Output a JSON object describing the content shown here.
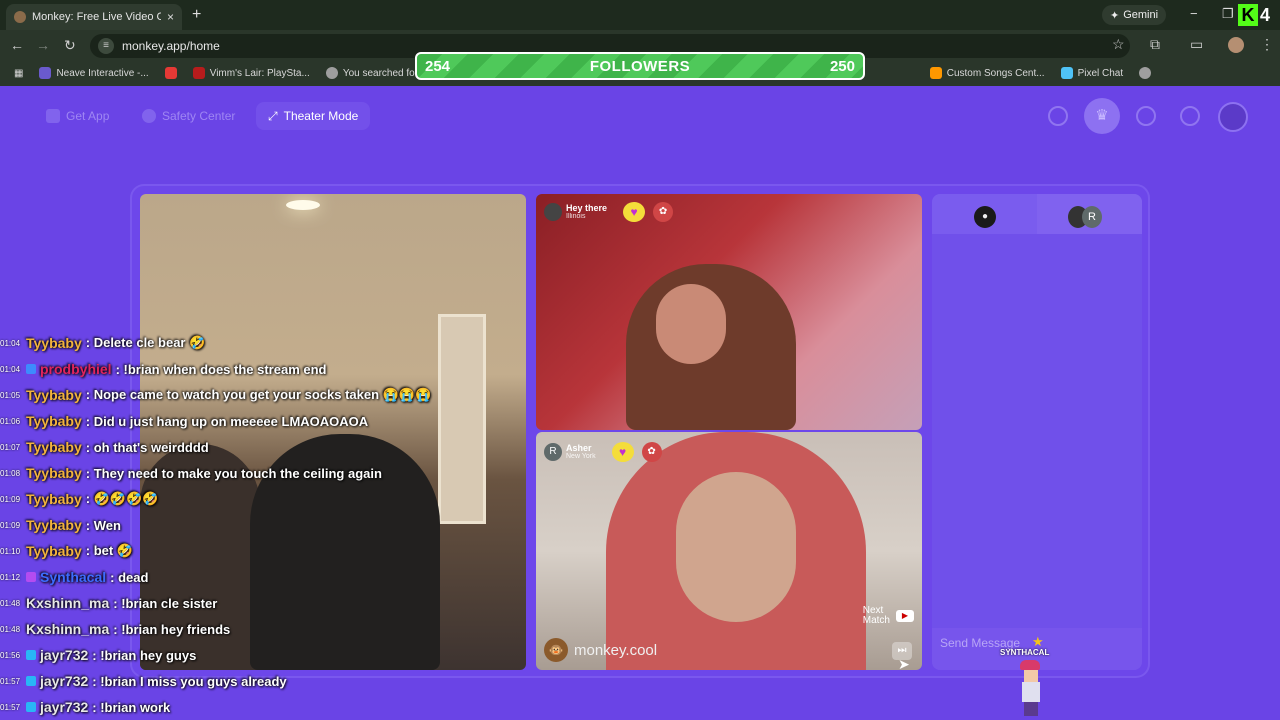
{
  "browser": {
    "tab_title": "Monkey: Free Live Video Ch",
    "tab_close": "×",
    "new_tab": "+",
    "gemini_label": "Gemini",
    "url": "monkey.app/home",
    "window_minimize": "−",
    "window_maximize": "❐",
    "kick_letter": "K",
    "kick_number": "4",
    "bookmarks": [
      {
        "label": "Neave Interactive -...",
        "color": "#6a5acd"
      },
      {
        "label": "",
        "color": "#e53935"
      },
      {
        "label": "Vimm's Lair: PlaySta...",
        "color": "#b71c1c"
      },
      {
        "label": "You searched for su...",
        "color": "#9e9e9e"
      },
      {
        "label": "Custom Songs Cent...",
        "color": "#ff9800"
      },
      {
        "label": "Pixel Chat",
        "color": "#4fc3f7"
      },
      {
        "label": "",
        "color": "#9e9e9e"
      }
    ]
  },
  "followers_goal": {
    "current": "254",
    "label": "FOLLOWERS",
    "target": "250"
  },
  "nav": {
    "get_app": "Get App",
    "safety_center": "Safety Center",
    "theater_mode": "Theater Mode"
  },
  "video": {
    "top_right_user": {
      "name": "Hey there",
      "location": "Illinois"
    },
    "bottom_right_user": {
      "initial": "R",
      "name": "Asher",
      "location": "New York"
    },
    "next_match_line1": "Next",
    "next_match_line2": "Match",
    "watermark": "monkey.cool"
  },
  "chat_panel": {
    "tab_right_initial": "R",
    "send_placeholder": "Send Message"
  },
  "overlay": {
    "synth_tag": "SYNTHACAL"
  },
  "stream_chat": [
    {
      "time": "01:04",
      "user": "Tyybaby",
      "color": "#f2b33d",
      "badge": "",
      "text": ": Delete cle bear 🤣"
    },
    {
      "time": "01:04",
      "user": "prodbyhiel",
      "color": "#e0245e",
      "badge": "#3d8bfd",
      "text": ": !brian when does the stream end"
    },
    {
      "time": "01:05",
      "user": "Tyybaby",
      "color": "#f2b33d",
      "badge": "",
      "text": ": Nope came to watch you get your socks taken 😭😭😭"
    },
    {
      "time": "01:06",
      "user": "Tyybaby",
      "color": "#f2b33d",
      "badge": "",
      "text": ": Did u just hang up on meeeee LMAOAOAOA"
    },
    {
      "time": "01:07",
      "user": "Tyybaby",
      "color": "#f2b33d",
      "badge": "",
      "text": ": oh that's weirdddd"
    },
    {
      "time": "01:08",
      "user": "Tyybaby",
      "color": "#f2b33d",
      "badge": "",
      "text": ": They need to make you touch the ceiling again"
    },
    {
      "time": "01:09",
      "user": "Tyybaby",
      "color": "#f2b33d",
      "badge": "",
      "text": ": 🤣🤣🤣🤣"
    },
    {
      "time": "01:09",
      "user": "Tyybaby",
      "color": "#f2b33d",
      "badge": "",
      "text": ": Wen"
    },
    {
      "time": "01:10",
      "user": "Tyybaby",
      "color": "#f2b33d",
      "badge": "",
      "text": ": bet 🤣"
    },
    {
      "time": "01:12",
      "user": "Synthacal",
      "color": "#3d6cff",
      "badge": "#b44cf0",
      "text": ": dead"
    },
    {
      "time": "01:48",
      "user": "Kxshinn_ma",
      "color": "#e8e8e8",
      "badge": "",
      "text": ": !brian cle sister"
    },
    {
      "time": "01:48",
      "user": "Kxshinn_ma",
      "color": "#e8e8e8",
      "badge": "",
      "text": ": !brian hey friends"
    },
    {
      "time": "01:56",
      "user": "jayr732",
      "color": "#e8e8e8",
      "badge": "#29b6f6",
      "text": ": !brian hey guys"
    },
    {
      "time": "01:57",
      "user": "jayr732",
      "color": "#e8e8e8",
      "badge": "#29b6f6",
      "text": ": !brian I miss you guys already"
    },
    {
      "time": "01:57",
      "user": "jayr732",
      "color": "#e8e8e8",
      "badge": "#29b6f6",
      "text": ": !brian work"
    }
  ]
}
